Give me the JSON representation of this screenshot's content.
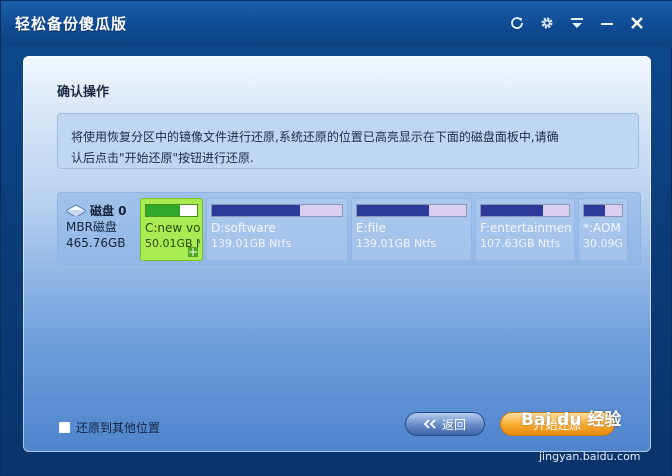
{
  "app": {
    "title": "轻松备份傻瓜版"
  },
  "title_controls": [
    {
      "name": "refresh-icon",
      "glyph": "⟳"
    },
    {
      "name": "gear-icon",
      "glyph": "⚙"
    },
    {
      "name": "menu-icon",
      "glyph": "▾"
    },
    {
      "name": "minimize-icon",
      "glyph": "−"
    },
    {
      "name": "close-icon",
      "glyph": "✕"
    }
  ],
  "section_title": "确认操作",
  "info_text_line1": "将使用恢复分区中的镜像文件进行还原,系统还原的位置已高亮显示在下面的磁盘面板中,请确",
  "info_text_line2": "认后点击\"开始还原\"按钮进行还原.",
  "disk": {
    "name": "磁盘 0",
    "type": "MBR磁盘",
    "size": "465.76GB",
    "partitions": [
      {
        "label": "C:new vo",
        "size": "50.01GB N",
        "used_fraction": 0.66,
        "selected": true
      },
      {
        "label": "D:software",
        "size": "139.01GB Ntfs",
        "used_fraction": 0.68,
        "selected": false
      },
      {
        "label": "E:file",
        "size": "139.01GB Ntfs",
        "used_fraction": 0.66,
        "selected": false
      },
      {
        "label": "F:entertainmen",
        "size": "107.63GB Ntfs",
        "used_fraction": 0.7,
        "selected": false
      },
      {
        "label": "*:AOM",
        "size": "30.09G",
        "used_fraction": 0.55,
        "selected": false
      }
    ]
  },
  "restore_other_location_label": "还原到其他位置",
  "buttons": {
    "back_label": "返回",
    "start_label": "开始还原"
  },
  "watermark": {
    "brand": "Bai du 经验",
    "url": "jingyan.baidu.com"
  }
}
